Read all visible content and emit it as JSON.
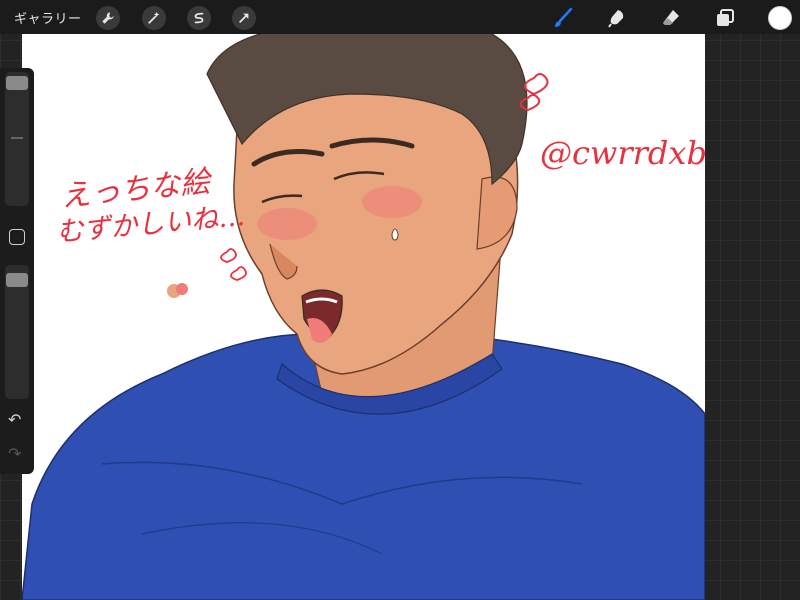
{
  "topbar": {
    "gallery_label": "ギャラリー",
    "left_tools": [
      "wrench-icon",
      "magic-wand-icon",
      "selection-icon",
      "transform-arrow-icon"
    ],
    "right_tools": [
      "brush-icon",
      "smudge-icon",
      "eraser-icon",
      "layers-icon"
    ],
    "active_tool": "brush-icon",
    "accent_color": "#1e7cff",
    "current_color": "#ffffff"
  },
  "sidebar": {
    "items": [
      "brush-size-slider",
      "modify-button",
      "opacity-slider",
      "undo-icon",
      "redo-icon"
    ],
    "undo_glyph": "↶",
    "redo_glyph": "↷"
  },
  "artwork": {
    "text_line1": "えっちな絵",
    "text_line2": "むずかしいね…",
    "handle": "@cwrrdxb",
    "ink_color": "#e8303f",
    "shirt_color": "#2f4fb3",
    "skin_color": "#e8a57e",
    "hair_color": "#5a4b42"
  }
}
